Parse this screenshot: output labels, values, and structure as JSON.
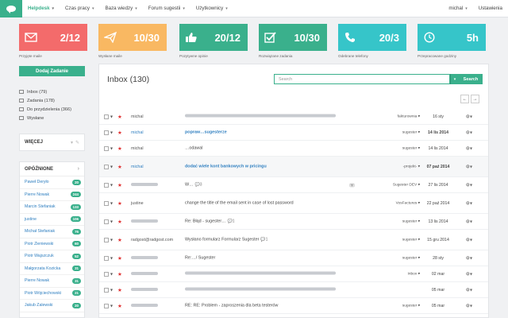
{
  "nav": {
    "items": [
      {
        "label": "Helpdesk",
        "active": true
      },
      {
        "label": "Czas pracy",
        "active": false
      },
      {
        "label": "Baza wiedzy",
        "active": false
      },
      {
        "label": "Forum sugestii",
        "active": false
      },
      {
        "label": "Użytkownicy",
        "active": false
      }
    ],
    "user": "michal",
    "settings": "Ustawienia"
  },
  "stats": [
    {
      "value": "2/12",
      "label": "Przyjęte maile",
      "color": "#f36b6b",
      "icon": "envelope-icon"
    },
    {
      "value": "10/30",
      "label": "Wysłane maile",
      "color": "#f9b862",
      "icon": "paper-plane-icon"
    },
    {
      "value": "20/12",
      "label": "Pozytywne opinie",
      "color": "#3ab08c",
      "icon": "thumbs-up-icon"
    },
    {
      "value": "10/30",
      "label": "Rozwiązane zadania",
      "color": "#3ab08c",
      "icon": "checkbox-icon"
    },
    {
      "value": "20/3",
      "label": "Odebrane telefony",
      "color": "#36c5c9",
      "icon": "phone-icon"
    },
    {
      "value": "5h",
      "label": "Przepracowane godziny",
      "color": "#36c5c9",
      "icon": "clock-icon"
    }
  ],
  "sidebar": {
    "add_button": "Dodaj Zadanie",
    "folders": [
      {
        "label": "Inbox (79)",
        "icon": "inbox-icon"
      },
      {
        "label": "Zadania (178)",
        "icon": "tasks-icon"
      },
      {
        "label": "Do przydzielenia (366)",
        "icon": "queue-icon"
      },
      {
        "label": "Wysłane",
        "icon": "sent-icon"
      }
    ],
    "more_label": "WIĘCEJ",
    "late_label": "OPÓŹNIONE",
    "late_items": [
      {
        "name": "Paweł Deryło",
        "count": "20"
      },
      {
        "name": "Pierre Nowak",
        "count": "244"
      },
      {
        "name": "Marcin Stefaniak",
        "count": "133"
      },
      {
        "name": "justine",
        "count": "106"
      },
      {
        "name": "Michał Stefaniak",
        "count": "76"
      },
      {
        "name": "Piotr Zieniewski",
        "count": "60"
      },
      {
        "name": "Piotr Wajszczuk",
        "count": "52"
      },
      {
        "name": "Małgorzata Kozicka",
        "count": "31"
      },
      {
        "name": "Pierre Nowak",
        "count": "31"
      },
      {
        "name": "Piotr Wójciechowski",
        "count": "21"
      },
      {
        "name": "Jakub Zalewski",
        "count": "20"
      }
    ]
  },
  "main": {
    "title": "Inbox (130)",
    "search_placeholder": "Search",
    "search_button": "Search",
    "rows": [
      {
        "from": "michal",
        "from_blurred": false,
        "from_blue": false,
        "subject": "",
        "subject_blurred": true,
        "count": "",
        "category": "fakturownia ▾",
        "date": "16 sty",
        "date_bold": false,
        "read": false
      },
      {
        "from": "michal",
        "from_blurred": false,
        "from_blue": true,
        "subject": "popraw…sugesterze",
        "subject_blurred": false,
        "count": "",
        "category": "sugester ▾",
        "date": "14 lis 2014",
        "date_bold": true,
        "read": false
      },
      {
        "from": "michal",
        "from_blurred": false,
        "from_blue": false,
        "subject": "…odawal",
        "subject_blurred": false,
        "count": "",
        "category": "sugester ▾",
        "date": "14 lis 2014",
        "date_bold": false,
        "read": false
      },
      {
        "from": "michal",
        "from_blurred": false,
        "from_blue": true,
        "subject": "dodać wiele kont bankowych w pricingu",
        "subject_blurred": false,
        "count": "",
        "category": "-projekt- ▾",
        "date": "07 paź 2014",
        "date_bold": true,
        "read": true
      },
      {
        "from": "",
        "from_blurred": true,
        "from_blue": false,
        "subject": "W…",
        "subject_blurred": false,
        "count": "3",
        "tag": "Y",
        "category": "Sugester DEV ▾",
        "date": "27 lis 2014",
        "date_bold": false,
        "read": false
      },
      {
        "from": "justine",
        "from_blurred": false,
        "from_blue": false,
        "subject": "change the title of the email sent in case of lost password",
        "subject_blurred": false,
        "count": "",
        "category": "VosFactures ▾",
        "date": "22 paź 2014",
        "date_bold": false,
        "read": false
      },
      {
        "from": "",
        "from_blurred": true,
        "from_blue": false,
        "subject": "Re: Błąd - sugester…",
        "subject_blurred": false,
        "count": "1",
        "category": "sugester ▾",
        "date": "13 lis 2014",
        "date_bold": false,
        "read": false
      },
      {
        "from": "radgost@radgost.com",
        "from_blurred": false,
        "from_blue": false,
        "subject": "Wysłano formularz Formularz Sugester",
        "subject_blurred": false,
        "count": "1",
        "category": "sugester ▾",
        "date": "15 gru 2014",
        "date_bold": false,
        "read": false
      },
      {
        "from": "",
        "from_blurred": true,
        "from_blue": false,
        "subject": "Re:…/ Sugester",
        "subject_blurred": false,
        "count": "",
        "category": "sugester ▾",
        "date": "28 sty",
        "date_bold": false,
        "read": false
      },
      {
        "from": "",
        "from_blurred": true,
        "from_blue": false,
        "subject": "",
        "subject_blurred": true,
        "count": "",
        "category": "Inbox ▾",
        "date": "02 mar",
        "date_bold": false,
        "read": false
      },
      {
        "from": "",
        "from_blurred": true,
        "from_blue": false,
        "subject": "",
        "subject_blurred": true,
        "count": "",
        "category": "",
        "date": "05 mar",
        "date_bold": false,
        "read": false
      },
      {
        "from": "",
        "from_blurred": true,
        "from_blue": false,
        "subject": "RE: RE: Problem - zaproszenia dla beta testerów",
        "subject_blurred": false,
        "count": "",
        "category": "sugester ▾",
        "date": "05 mar",
        "date_bold": false,
        "read": false
      }
    ]
  }
}
